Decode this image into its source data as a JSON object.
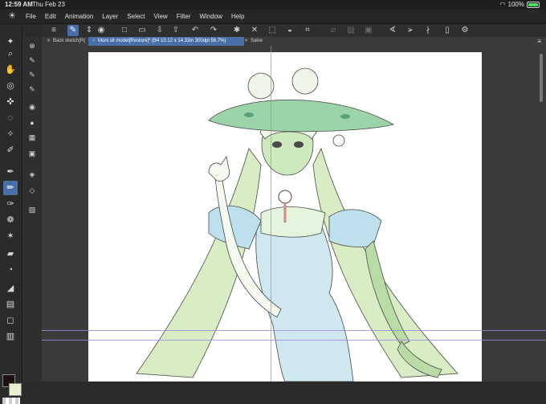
{
  "status": {
    "time": "12:59 AM",
    "date": "Thu Feb 23",
    "battery": "100%",
    "battery_level": 1.0
  },
  "menu": [
    "File",
    "Edit",
    "Animation",
    "Layer",
    "Select",
    "View",
    "Filter",
    "Window",
    "Help"
  ],
  "tabs": [
    {
      "label": "Back sketch[R("
    },
    {
      "label": "Moni sit model[Restore]* (B4 10.12 x 14.33in 300dpi 56.7%)"
    },
    {
      "label": "Sakie"
    }
  ],
  "colors": {
    "accent": "#4a6fa8",
    "main_color": "#1e1010",
    "sub_color": "#e8f0d0"
  }
}
